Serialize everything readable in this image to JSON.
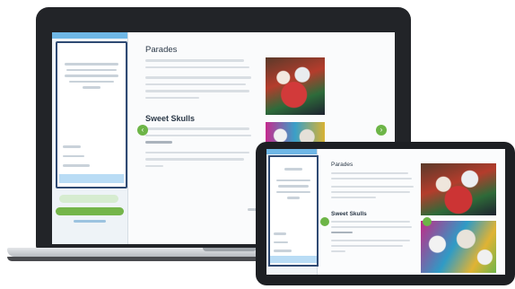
{
  "laptop": {
    "main": {
      "title": "Parades",
      "subtitle": "Sweet Skulls"
    },
    "carousel": {
      "prev_icon": "chevron-left-icon",
      "next_icon": "chevron-right-icon"
    }
  },
  "tablet": {
    "main": {
      "title": "Parades",
      "subtitle": "Sweet Skulls"
    }
  },
  "colors": {
    "accent_green": "#6db547",
    "accent_blue": "#6fb7e6",
    "panel_border": "#2f4a73",
    "device_frame": "#222428"
  }
}
